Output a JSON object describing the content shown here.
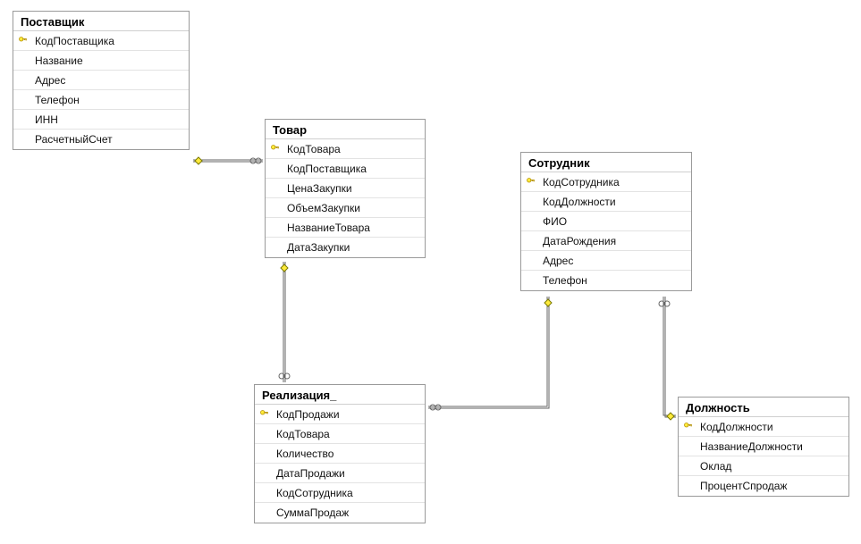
{
  "entities": {
    "postavshik": {
      "title": "Поставщик",
      "fields": [
        {
          "name": "КодПоставщика",
          "pk": true
        },
        {
          "name": "Название",
          "pk": false
        },
        {
          "name": "Адрес",
          "pk": false
        },
        {
          "name": "Телефон",
          "pk": false
        },
        {
          "name": "ИНН",
          "pk": false
        },
        {
          "name": "РасчетныйСчет",
          "pk": false
        }
      ]
    },
    "tovar": {
      "title": "Товар",
      "fields": [
        {
          "name": "КодТовара",
          "pk": true
        },
        {
          "name": "КодПоставщика",
          "pk": false
        },
        {
          "name": "ЦенаЗакупки",
          "pk": false
        },
        {
          "name": "ОбъемЗакупки",
          "pk": false
        },
        {
          "name": "НазваниеТовара",
          "pk": false
        },
        {
          "name": "ДатаЗакупки",
          "pk": false
        }
      ]
    },
    "sotrudnik": {
      "title": "Сотрудник",
      "fields": [
        {
          "name": "КодСотрудника",
          "pk": true
        },
        {
          "name": "КодДолжности",
          "pk": false
        },
        {
          "name": "ФИО",
          "pk": false
        },
        {
          "name": "ДатаРождения",
          "pk": false
        },
        {
          "name": "Адрес",
          "pk": false
        },
        {
          "name": "Телефон",
          "pk": false
        }
      ]
    },
    "realizacia": {
      "title": "Реализация_",
      "fields": [
        {
          "name": "КодПродажи",
          "pk": true
        },
        {
          "name": "КодТовара",
          "pk": false
        },
        {
          "name": "Количество",
          "pk": false
        },
        {
          "name": "ДатаПродажи",
          "pk": false
        },
        {
          "name": "КодСотрудника",
          "pk": false
        },
        {
          "name": "СуммаПродаж",
          "pk": false
        }
      ]
    },
    "dolzhnost": {
      "title": "Должность",
      "fields": [
        {
          "name": "КодДолжности",
          "pk": true
        },
        {
          "name": "НазваниеДолжности",
          "pk": false
        },
        {
          "name": "Оклад",
          "pk": false
        },
        {
          "name": "ПроцентСпродаж",
          "pk": false
        }
      ]
    }
  },
  "relationships": [
    {
      "from": "postavshik",
      "to": "tovar",
      "type": "one-to-many"
    },
    {
      "from": "tovar",
      "to": "realizacia",
      "type": "one-to-many"
    },
    {
      "from": "sotrudnik",
      "to": "realizacia",
      "type": "one-to-many"
    },
    {
      "from": "sotrudnik",
      "to": "dolzhnost",
      "type": "many-to-one"
    }
  ]
}
